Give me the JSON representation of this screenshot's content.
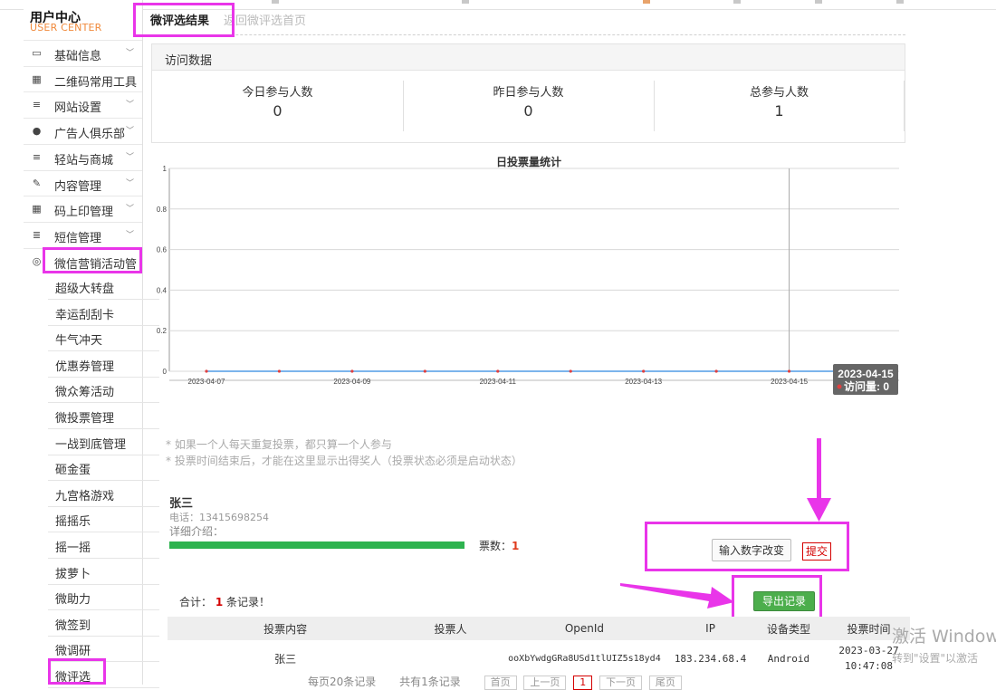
{
  "header": {
    "title": "用户中心",
    "subtitle": "USER CENTER"
  },
  "sidebar": {
    "menus": [
      {
        "label": "基础信息",
        "icon": "monitor-icon",
        "chevron": true
      },
      {
        "label": "二维码常用工具",
        "icon": "qrcode-icon",
        "chevron": false
      },
      {
        "label": "网站设置",
        "icon": "list-icon",
        "chevron": true
      },
      {
        "label": "广告人俱乐部",
        "icon": "chat-icon",
        "chevron": true
      },
      {
        "label": "轻站与商城",
        "icon": "list-icon",
        "chevron": true
      },
      {
        "label": "内容管理",
        "icon": "edit-icon",
        "chevron": true
      },
      {
        "label": "码上印管理",
        "icon": "qrcode-icon",
        "chevron": true
      },
      {
        "label": "短信管理",
        "icon": "database-icon",
        "chevron": true
      },
      {
        "label": "微信营销活动管",
        "icon": "lifebuoy-icon",
        "chevron": false
      }
    ],
    "submenu": [
      "超级大转盘",
      "幸运刮刮卡",
      "牛气冲天",
      "优惠券管理",
      "微众筹活动",
      "微投票管理",
      "一战到底管理",
      "砸金蛋",
      "九宫格游戏",
      "摇摇乐",
      "摇一摇",
      "拔萝卜",
      "微助力",
      "微签到",
      "微调研",
      "微评选"
    ]
  },
  "tabs": {
    "active": "微评选结果",
    "back": "返回微评选首页"
  },
  "visit": {
    "title": "访问数据",
    "stats": [
      {
        "label": "今日参与人数",
        "value": "0"
      },
      {
        "label": "昨日参与人数",
        "value": "0"
      },
      {
        "label": "总参与人数",
        "value": "1"
      }
    ]
  },
  "chart_data": {
    "type": "line",
    "title": "日投票量统计",
    "x": [
      "2023-04-07",
      "2023-04-08",
      "2023-04-09",
      "2023-04-10",
      "2023-04-11",
      "2023-04-12",
      "2023-04-13",
      "2023-04-14",
      "2023-04-15",
      "2023-04-16"
    ],
    "xticklabels": [
      "2023-04-07",
      "2023-04-09",
      "2023-04-11",
      "2023-04-13",
      "2023-04-15"
    ],
    "series": [
      {
        "name": "访问量",
        "values": [
          0,
          0,
          0,
          0,
          0,
          0,
          0,
          0,
          0,
          0
        ],
        "color": "#7cb5ec"
      }
    ],
    "ylim": [
      0,
      1
    ],
    "yticks": [
      "0",
      "0.2",
      "0.4",
      "0.6",
      "0.8",
      "1"
    ],
    "tooltip": {
      "date": "2023-04-15",
      "label": "访问量",
      "value": "0"
    },
    "grid": true
  },
  "tips": [
    "* 如果一个人每天重复投票，都只算一个人参与",
    "* 投票时间结束后，才能在这里显示出得奖人（投票状态必须是启动状态）"
  ],
  "candidate": {
    "name": "张三",
    "phone": "电话：13415698254",
    "intro": "详细介绍：",
    "votes_label": "票数：",
    "votes": "1",
    "vote_fraction": 1.0
  },
  "actions": {
    "input_button": "输入数字改变",
    "submit": "提交",
    "export": "导出记录"
  },
  "summary": {
    "prefix": "合计：",
    "count": "1",
    "suffix": "条记录！"
  },
  "table": {
    "headers": [
      "投票内容",
      "投票人",
      "OpenId",
      "IP",
      "设备类型",
      "投票时间"
    ],
    "rows": [
      [
        "张三",
        "",
        "ooXbYwdgGRa8USd1tlUIZ5s18yd4",
        "183.234.68.4",
        "Android",
        "2023-03-27 10:47:08"
      ]
    ]
  },
  "pager": {
    "per_page": "每页20条记录",
    "total": "共有1条记录",
    "first": "首页",
    "prev": "上一页",
    "current": "1",
    "next": "下一页",
    "last": "尾页"
  },
  "watermark": {
    "line1": "激活 Windows",
    "line2": "转到\"设置\"以激活"
  },
  "colors": {
    "highlight": "#e935e9",
    "accent": "#f08a3c",
    "export": "#4cae4c",
    "progress": "#2eb34f",
    "danger": "#d40000"
  }
}
